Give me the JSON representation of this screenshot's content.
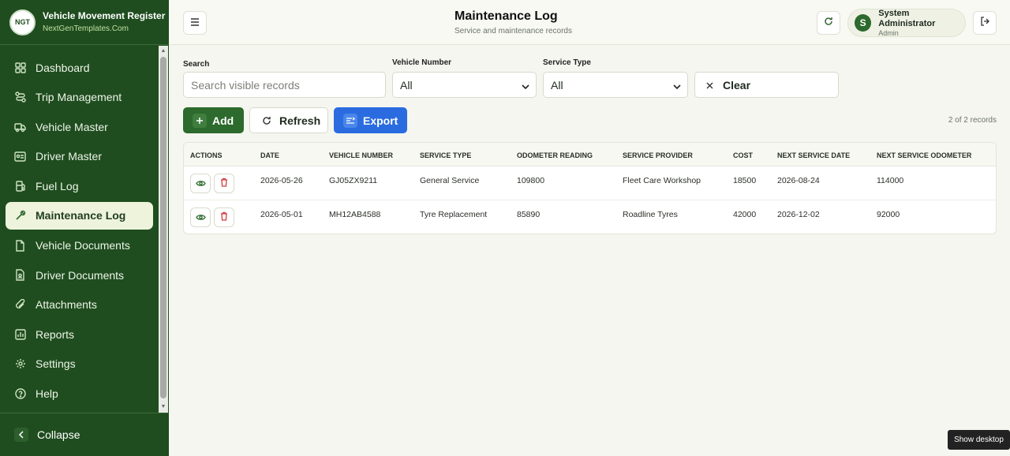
{
  "brand": {
    "title": "Vehicle Movement Register",
    "subtitle": "NextGenTemplates.Com",
    "logo_text": "NGT"
  },
  "sidebar": {
    "items": [
      {
        "label": "Dashboard",
        "icon": "grid-icon"
      },
      {
        "label": "Trip Management",
        "icon": "route-icon"
      },
      {
        "label": "Vehicle Master",
        "icon": "truck-icon"
      },
      {
        "label": "Driver Master",
        "icon": "id-card-icon"
      },
      {
        "label": "Fuel Log",
        "icon": "fuel-icon"
      },
      {
        "label": "Maintenance Log",
        "icon": "wrench-icon",
        "active": true
      },
      {
        "label": "Vehicle Documents",
        "icon": "document-icon"
      },
      {
        "label": "Driver Documents",
        "icon": "file-user-icon"
      },
      {
        "label": "Attachments",
        "icon": "paperclip-icon"
      },
      {
        "label": "Reports",
        "icon": "bar-chart-icon"
      },
      {
        "label": "Settings",
        "icon": "gear-icon"
      },
      {
        "label": "Help",
        "icon": "help-circle-icon"
      }
    ],
    "collapse_label": "Collapse"
  },
  "header": {
    "title": "Maintenance Log",
    "subtitle": "Service and maintenance records",
    "user": {
      "name": "System Administrator",
      "role": "Admin",
      "initial": "S"
    }
  },
  "filters": {
    "search_label": "Search",
    "search_placeholder": "Search visible records",
    "vehicle_label": "Vehicle Number",
    "vehicle_value": "All",
    "service_label": "Service Type",
    "service_value": "All",
    "clear_label": "Clear"
  },
  "toolbar": {
    "add_label": "Add",
    "refresh_label": "Refresh",
    "export_label": "Export",
    "records_text": "2 of 2 records"
  },
  "table": {
    "columns": [
      "ACTIONS",
      "DATE",
      "VEHICLE NUMBER",
      "SERVICE TYPE",
      "ODOMETER READING",
      "SERVICE PROVIDER",
      "COST",
      "NEXT SERVICE DATE",
      "NEXT SERVICE ODOMETER"
    ],
    "rows": [
      {
        "date": "2026-05-26",
        "vehicle": "GJ05ZX9211",
        "service": "General Service",
        "odometer": "109800",
        "provider": "Fleet Care Workshop",
        "cost": "18500",
        "next_date": "2026-08-24",
        "next_odometer": "114000"
      },
      {
        "date": "2026-05-01",
        "vehicle": "MH12AB4588",
        "service": "Tyre Replacement",
        "odometer": "85890",
        "provider": "Roadline Tyres",
        "cost": "42000",
        "next_date": "2026-12-02",
        "next_odometer": "92000"
      }
    ]
  },
  "taskbar": {
    "show_desktop": "Show desktop"
  },
  "colors": {
    "sidebar": "#1f4d1f",
    "accent_green": "#2d6a2d",
    "export_blue": "#2a6ce0",
    "delete_red": "#d33b3b"
  }
}
